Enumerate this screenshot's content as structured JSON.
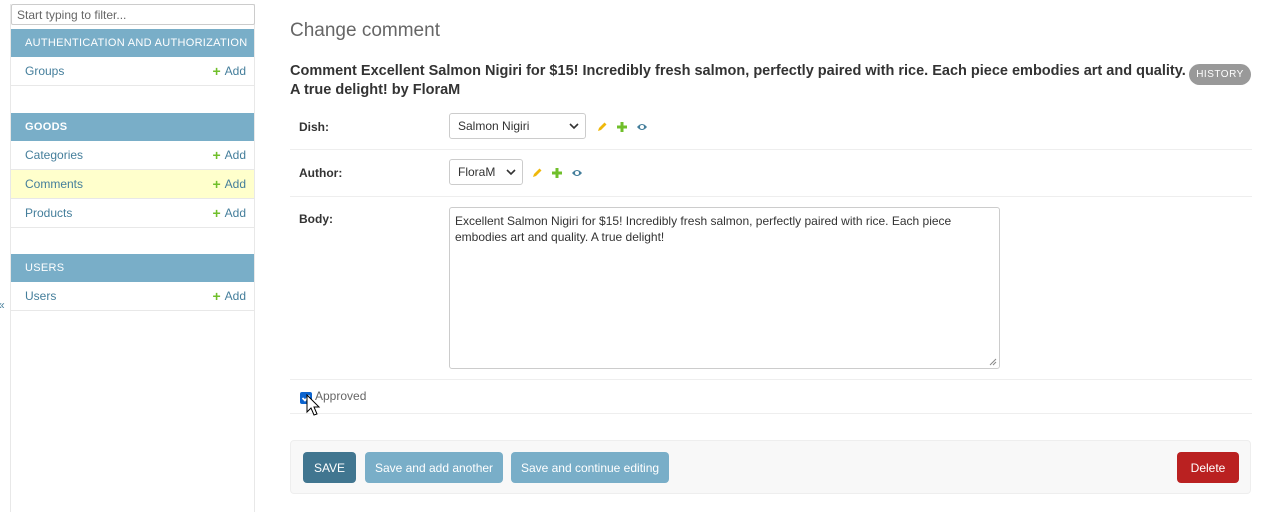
{
  "sidebar": {
    "filter_placeholder": "Start typing to filter...",
    "collapse_glyph": "«",
    "modules": [
      {
        "caption": "Authentication and Authorization",
        "models": [
          {
            "name": "Groups",
            "add_label": "Add"
          }
        ]
      },
      {
        "caption": "Goods",
        "models": [
          {
            "name": "Categories",
            "add_label": "Add"
          },
          {
            "name": "Comments",
            "add_label": "Add",
            "selected": true
          },
          {
            "name": "Products",
            "add_label": "Add"
          }
        ]
      },
      {
        "caption": "Users",
        "models": [
          {
            "name": "Users",
            "add_label": "Add"
          }
        ]
      }
    ]
  },
  "main": {
    "page_title": "Change comment",
    "object_title": "Comment Excellent Salmon Nigiri for $15! Incredibly fresh salmon, perfectly paired with rice. Each piece embodies art and quality. A true delight! by FloraM",
    "history_label": "HISTORY",
    "fields": {
      "dish": {
        "label": "Dish:",
        "value": "Salmon Nigiri"
      },
      "author": {
        "label": "Author:",
        "value": "FloraM"
      },
      "body": {
        "label": "Body:",
        "value": "Excellent Salmon Nigiri for $15! Incredibly fresh salmon, perfectly paired with rice. Each piece embodies art and quality. A true delight!"
      },
      "approved": {
        "label": "Approved",
        "checked": true
      }
    },
    "buttons": {
      "save": "SAVE",
      "save_add_another": "Save and add another",
      "save_continue": "Save and continue editing",
      "delete": "Delete"
    }
  },
  "icons": {
    "change": "pencil-icon",
    "add": "plus-icon",
    "view": "eye-icon"
  },
  "colors": {
    "module_header": "#79aec8",
    "link": "#447e9b",
    "add_green": "#70bf2b",
    "save_button": "#417690",
    "secondary_button": "#79aec8",
    "delete_button": "#ba2121",
    "selected_row": "#ffffcc",
    "history_button": "#999999"
  }
}
